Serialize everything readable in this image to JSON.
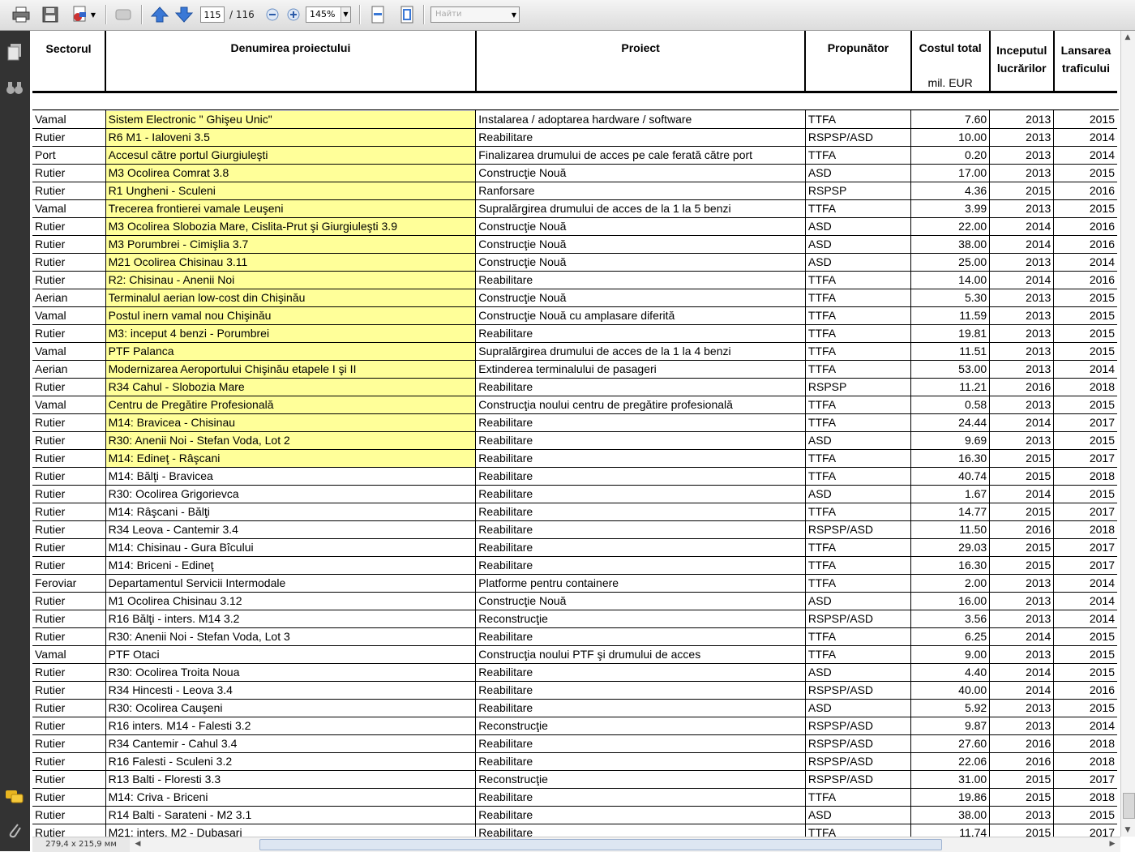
{
  "toolbar": {
    "page_current": "115",
    "page_total": "/ 116",
    "zoom": "145%",
    "search_placeholder": "Найти"
  },
  "status": {
    "page_size": "279,4 x 215,9 мм"
  },
  "table": {
    "headers": {
      "sectorul": "Sectorul",
      "denumirea": "Denumirea proiectului",
      "proiect": "Proiect",
      "propunator": "Propunător",
      "costul": "Costul total",
      "costul_unit": "mil. EUR",
      "inceputul_1": "Inceputul",
      "inceputul_2": "lucrărilor",
      "lansarea_1": "Lansarea",
      "lansarea_2": "traficului"
    },
    "rows": [
      [
        "Vamal",
        "Sistem Electronic \" Ghişeu Unic\"",
        "Instalarea / adoptarea hardware / software",
        "TTFA",
        "7.60",
        "2013",
        "2015",
        true
      ],
      [
        "Rutier",
        "R6 M1 - Ialoveni 3.5",
        "Reabilitare",
        "RSPSP/ASD",
        "10.00",
        "2013",
        "2014",
        true
      ],
      [
        "Port",
        "Accesul către portul Giurgiuleşti",
        "Finalizarea drumului de acces pe cale ferată către port",
        "TTFA",
        "0.20",
        "2013",
        "2014",
        true
      ],
      [
        "Rutier",
        "M3 Ocolirea Comrat 3.8",
        "Construcţie Nouă",
        "ASD",
        "17.00",
        "2013",
        "2015",
        true
      ],
      [
        "Rutier",
        "R1 Ungheni - Sculeni",
        "Ranforsare",
        "RSPSP",
        "4.36",
        "2015",
        "2016",
        true
      ],
      [
        "Vamal",
        "Trecerea frontierei vamale Leuşeni",
        "Supralărgirea drumului de acces de la 1 la 5 benzi",
        "TTFA",
        "3.99",
        "2013",
        "2015",
        true
      ],
      [
        "Rutier",
        "M3 Ocolirea Slobozia Mare, Cislita-Prut şi Giurgiuleşti 3.9",
        "Construcţie Nouă",
        "ASD",
        "22.00",
        "2014",
        "2016",
        true
      ],
      [
        "Rutier",
        "M3 Porumbrei - Cimişlia 3.7",
        "Construcţie Nouă",
        "ASD",
        "38.00",
        "2014",
        "2016",
        true
      ],
      [
        "Rutier",
        "M21 Ocolirea Chisinau 3.11",
        "Construcţie Nouă",
        "ASD",
        "25.00",
        "2013",
        "2014",
        true
      ],
      [
        "Rutier",
        "R2: Chisinau  - Anenii Noi",
        "Reabilitare",
        "TTFA",
        "14.00",
        "2014",
        "2016",
        true
      ],
      [
        "Aerian",
        "Terminalul aerian low-cost din Chişinău",
        "Construcţie Nouă",
        "TTFA",
        "5.30",
        "2013",
        "2015",
        true
      ],
      [
        "Vamal",
        "Postul inern vamal nou Chişinău",
        "Construcţie Nouă cu amplasare diferită",
        "TTFA",
        "11.59",
        "2013",
        "2015",
        true
      ],
      [
        "Rutier",
        "M3: inceput 4 benzi - Porumbrei",
        "Reabilitare",
        "TTFA",
        "19.81",
        "2013",
        "2015",
        true
      ],
      [
        "Vamal",
        "PTF Palanca",
        "Supralărgirea drumului de acces de la 1 la 4 benzi",
        "TTFA",
        "11.51",
        "2013",
        "2015",
        true
      ],
      [
        "Aerian",
        "Modernizarea Aeroportului Chişinău etapele I şi II",
        "Extinderea terminalului de pasageri",
        "TTFA",
        "53.00",
        "2013",
        "2014",
        true
      ],
      [
        "Rutier",
        "R34 Cahul - Slobozia Mare",
        "Reabilitare",
        "RSPSP",
        "11.21",
        "2016",
        "2018",
        true
      ],
      [
        "Vamal",
        "Centru de Pregătire Profesională",
        "Construcţia noului centru de pregătire profesională",
        "TTFA",
        "0.58",
        "2013",
        "2015",
        true
      ],
      [
        "Rutier",
        "M14: Bravicea - Chisinau",
        "Reabilitare",
        "TTFA",
        "24.44",
        "2014",
        "2017",
        true
      ],
      [
        "Rutier",
        "R30: Anenii Noi - Stefan Voda, Lot 2",
        "Reabilitare",
        "ASD",
        "9.69",
        "2013",
        "2015",
        true
      ],
      [
        "Rutier",
        "M14: Edineţ - Râşcani",
        "Reabilitare",
        "TTFA",
        "16.30",
        "2015",
        "2017",
        true
      ],
      [
        "Rutier",
        "M14: Bălţi - Bravicea",
        "Reabilitare",
        "TTFA",
        "40.74",
        "2015",
        "2018",
        false
      ],
      [
        "Rutier",
        "R30: Ocolirea Grigorievca",
        "Reabilitare",
        "ASD",
        "1.67",
        "2014",
        "2015",
        false
      ],
      [
        "Rutier",
        "M14: Râşcani - Bălţi",
        "Reabilitare",
        "TTFA",
        "14.77",
        "2015",
        "2017",
        false
      ],
      [
        "Rutier",
        "R34 Leova - Cantemir 3.4",
        "Reabilitare",
        "RSPSP/ASD",
        "11.50",
        "2016",
        "2018",
        false
      ],
      [
        "Rutier",
        "M14: Chisinau - Gura Bîcului",
        "Reabilitare",
        "TTFA",
        "29.03",
        "2015",
        "2017",
        false
      ],
      [
        "Rutier",
        "M14: Briceni - Edineţ",
        "Reabilitare",
        "TTFA",
        "16.30",
        "2015",
        "2017",
        false
      ],
      [
        "Feroviar",
        "Departamentul Servicii Intermodale",
        "Platforme pentru containere",
        "TTFA",
        "2.00",
        "2013",
        "2014",
        false
      ],
      [
        "Rutier",
        "M1 Ocolirea Chisinau 3.12",
        "Construcţie Nouă",
        "ASD",
        "16.00",
        "2013",
        "2014",
        false
      ],
      [
        "Rutier",
        "R16 Bălţi - inters. M14 3.2",
        "Reconstrucţie",
        "RSPSP/ASD",
        "3.56",
        "2013",
        "2014",
        false
      ],
      [
        "Rutier",
        "R30: Anenii Noi - Stefan Voda, Lot 3",
        "Reabilitare",
        "TTFA",
        "6.25",
        "2014",
        "2015",
        false
      ],
      [
        "Vamal",
        "PTF Otaci",
        "Construcţia noului PTF şi drumului de acces",
        "TTFA",
        "9.00",
        "2013",
        "2015",
        false
      ],
      [
        "Rutier",
        "R30: Ocolirea Troita Noua",
        "Reabilitare",
        "ASD",
        "4.40",
        "2014",
        "2015",
        false
      ],
      [
        "Rutier",
        "R34 Hincesti - Leova 3.4",
        "Reabilitare",
        "RSPSP/ASD",
        "40.00",
        "2014",
        "2016",
        false
      ],
      [
        "Rutier",
        "R30: Ocolirea Cauşeni",
        "Reabilitare",
        "ASD",
        "5.92",
        "2013",
        "2015",
        false
      ],
      [
        "Rutier",
        "R16 inters. M14 - Falesti 3.2",
        "Reconstrucţie",
        "RSPSP/ASD",
        "9.87",
        "2013",
        "2014",
        false
      ],
      [
        "Rutier",
        "R34 Cantemir - Cahul 3.4",
        "Reabilitare",
        "RSPSP/ASD",
        "27.60",
        "2016",
        "2018",
        false
      ],
      [
        "Rutier",
        "R16 Falesti - Sculeni 3.2",
        "Reabilitare",
        "RSPSP/ASD",
        "22.06",
        "2016",
        "2018",
        false
      ],
      [
        "Rutier",
        "R13 Balti - Floresti 3.3",
        "Reconstrucţie",
        "RSPSP/ASD",
        "31.00",
        "2015",
        "2017",
        false
      ],
      [
        "Rutier",
        "M14: Criva - Briceni",
        "Reabilitare",
        "TTFA",
        "19.86",
        "2015",
        "2018",
        false
      ],
      [
        "Rutier",
        "R14 Balti - Sarateni - M2 3.1",
        "Reabilitare",
        "ASD",
        "38.00",
        "2013",
        "2015",
        false
      ],
      [
        "Rutier",
        "M21: inters. M2 - Dubasari",
        "Reabilitare",
        "TTFA",
        "11.74",
        "2015",
        "2017",
        false
      ]
    ]
  },
  "colors": {
    "highlight": "#ffff99",
    "sidebar": "#333333"
  }
}
